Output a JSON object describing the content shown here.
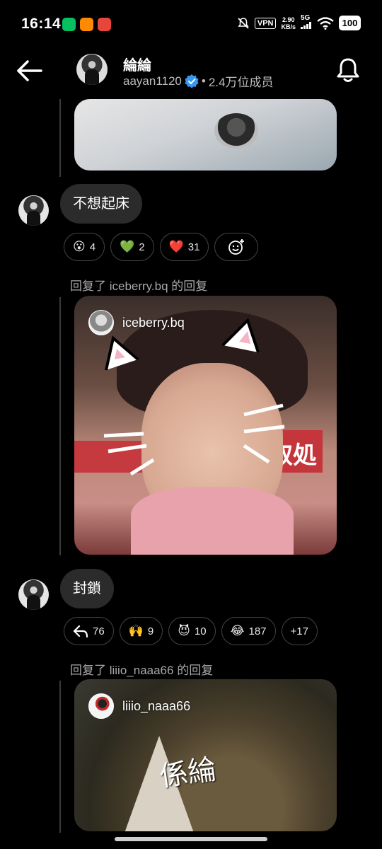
{
  "status_bar": {
    "time": "16:14",
    "vpn": "VPN",
    "speed_value": "2.90",
    "speed_unit": "KB/s",
    "network": "5G",
    "battery": "100",
    "app_icon_colors": [
      "#07c160",
      "#ff8a00",
      "#e8463a"
    ]
  },
  "header": {
    "group_name": "綸綸",
    "owner_handle": "aayan1120",
    "separator": "•",
    "member_count": "2.4万位成员",
    "back_icon": "arrow-left-icon",
    "bell_icon": "bell-icon"
  },
  "messages": [
    {
      "text": "不想起床",
      "reactions": [
        {
          "emoji": "😮",
          "count": "4"
        },
        {
          "emoji": "💚",
          "count": "2"
        },
        {
          "emoji": "❤️",
          "count": "31"
        }
      ],
      "add_reaction_icon": "add-emoji-icon"
    },
    {
      "text": "封鎖",
      "reactions": [
        {
          "emoji": "↩",
          "count": "76"
        },
        {
          "emoji": "🙌",
          "count": "9"
        },
        {
          "emoji": "😈",
          "count": "10"
        },
        {
          "emoji": "😂",
          "count": "187"
        }
      ],
      "more_reactions": "+17"
    }
  ],
  "replies": [
    {
      "label": "回复了 iceberry.bq 的回复",
      "card_user": "iceberry.bq",
      "sign_text": "取処"
    },
    {
      "label": "回复了 liiio_naaa66 的回复",
      "card_user": "liiio_naaa66",
      "overlay_text": "係綸"
    }
  ],
  "colors": {
    "background": "#000000",
    "bubble": "#2b2b2b",
    "verified": "#3897f0",
    "pill_border": "#444444"
  }
}
